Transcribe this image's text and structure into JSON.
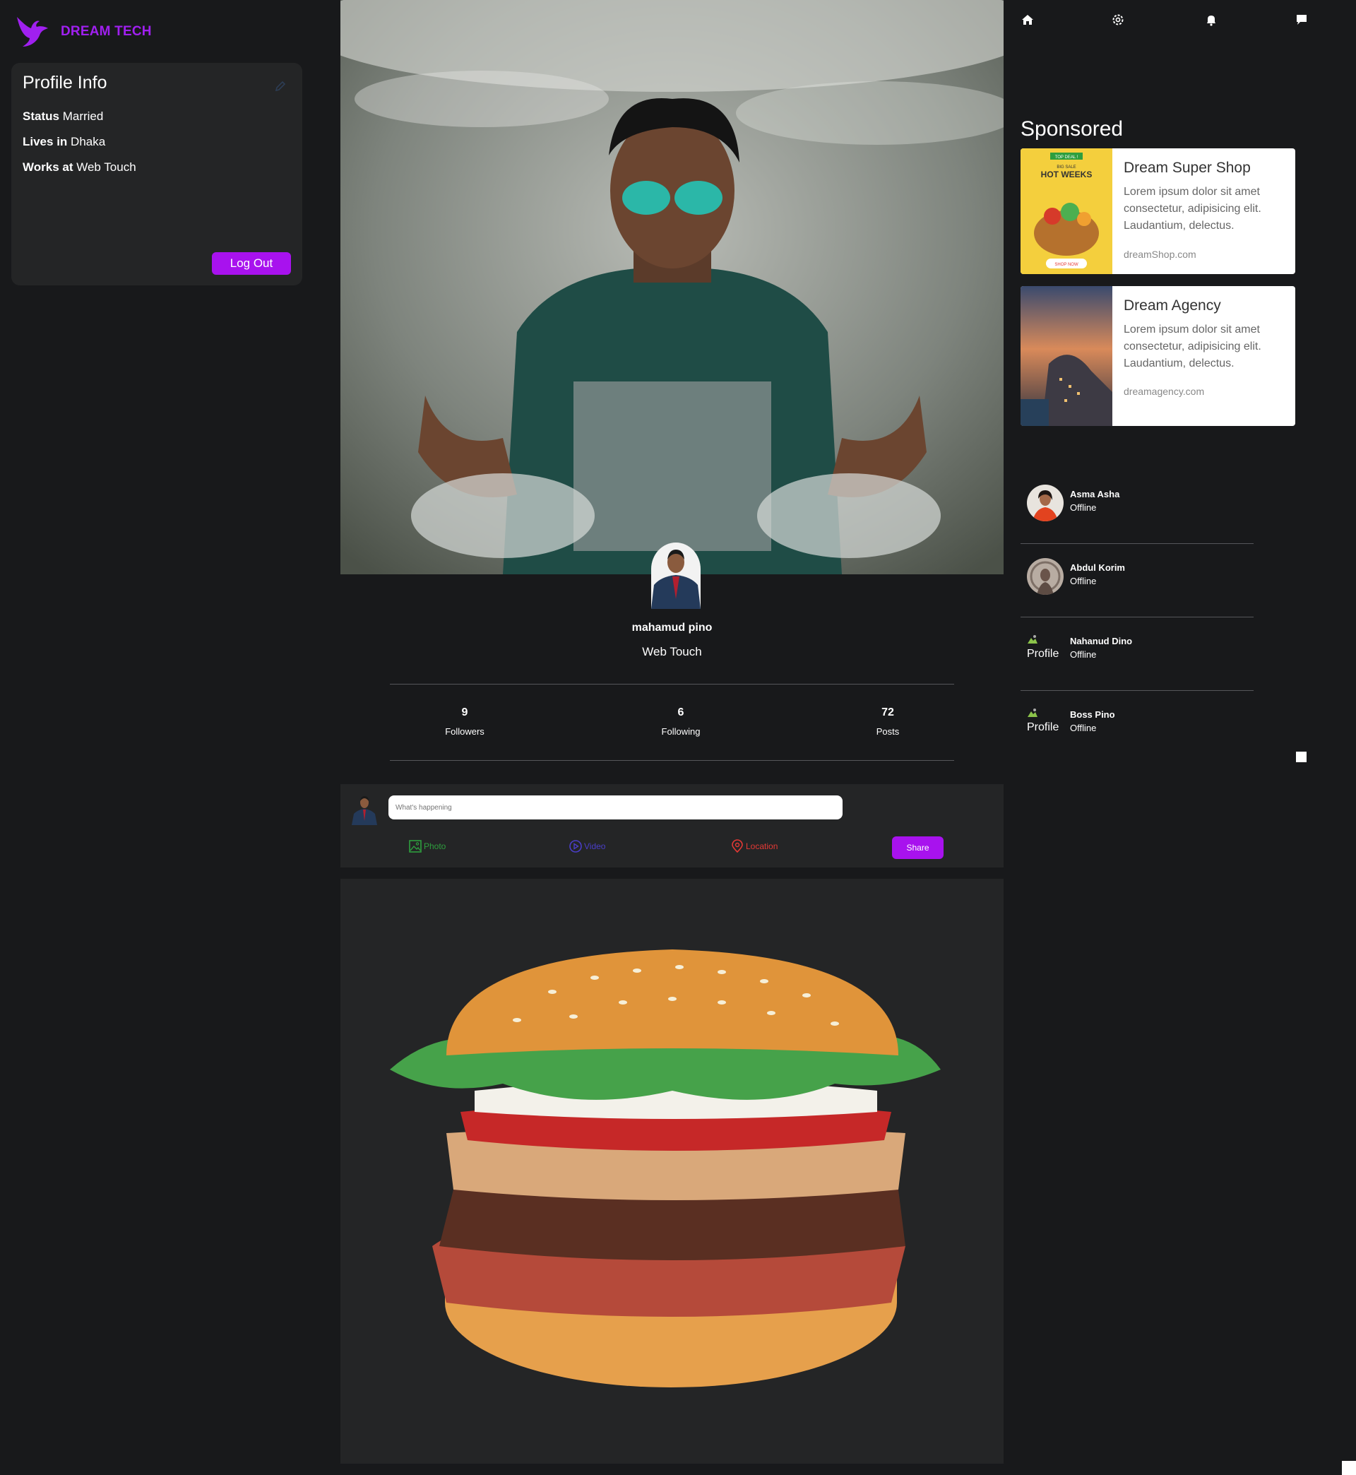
{
  "brand": {
    "name": "DREAM TECH",
    "color": "#a020f0"
  },
  "profile_info": {
    "title": "Profile Info",
    "status_label": "Status",
    "status_value": "Married",
    "lives_label": "Lives in",
    "lives_value": "Dhaka",
    "works_label": "Works at",
    "works_value": "Web Touch",
    "logout_label": "Log Out"
  },
  "user": {
    "name": "mahamud pino",
    "company": "Web Touch"
  },
  "stats": [
    {
      "value": "9",
      "label": "Followers"
    },
    {
      "value": "6",
      "label": "Following"
    },
    {
      "value": "72",
      "label": "Posts"
    }
  ],
  "composer": {
    "placeholder": "What's happening",
    "photo": "Photo",
    "video": "Video",
    "location": "Location",
    "share": "Share"
  },
  "nav_icons": [
    "home-icon",
    "settings-icon",
    "notification-icon",
    "chat-icon"
  ],
  "sponsored": {
    "title": "Sponsored",
    "ads": [
      {
        "name": "Dream Super Shop",
        "desc": "Lorem ipsum dolor sit amet consectetur, adipisicing elit. Laudantium, delectus.",
        "site": "dreamShop.com",
        "thumb_text": {
          "tag": "TOP DEAL !",
          "sub": "BIG SALE",
          "headline": "HOT WEEKS",
          "cta": "SHOP NOW"
        }
      },
      {
        "name": "Dream Agency",
        "desc": "Lorem ipsum dolor sit amet consectetur, adipisicing elit. Laudantium, delectus.",
        "site": "dreamagency.com"
      }
    ]
  },
  "friends": [
    {
      "name": "Asma Asha",
      "status": "Offline",
      "alt": ""
    },
    {
      "name": "Abdul Korim",
      "status": "Offline",
      "alt": ""
    },
    {
      "name": "Nahanud Dino",
      "status": "Offline",
      "alt": "Profile"
    },
    {
      "name": "Boss Pino",
      "status": "Offline",
      "alt": "Profile"
    }
  ],
  "colors": {
    "accent": "#a812ee",
    "bg": "#18191b",
    "card": "#242526",
    "photo": "#2e9e3e",
    "video": "#4a3ec8",
    "location": "#e53935"
  }
}
